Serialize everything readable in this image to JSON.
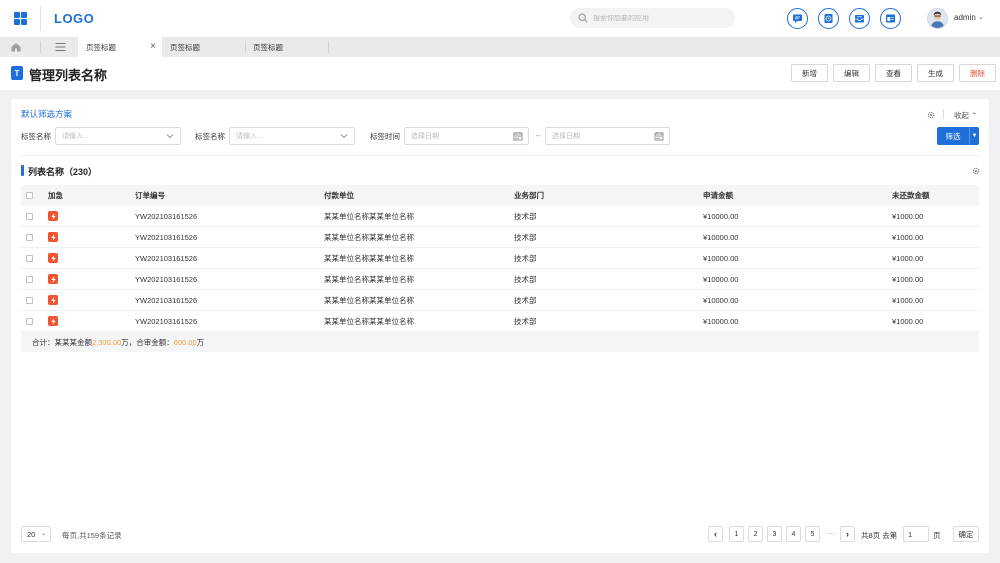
{
  "header": {
    "logo": "LOGO",
    "search_placeholder": "搜索你想要的应用",
    "user_name": "admin"
  },
  "tabs": {
    "items": [
      {
        "label": "页签标题"
      },
      {
        "label": "页签标题"
      },
      {
        "label": "页签标题"
      }
    ]
  },
  "page": {
    "title_icon": "T",
    "title": "管理列表名称",
    "actions": {
      "add": "新增",
      "edit": "编辑",
      "view": "查看",
      "generate": "生成",
      "delete": "删除"
    }
  },
  "filter": {
    "scheme_title": "默认筛选方案",
    "collapse_label": "收起",
    "field1_label": "标签名称",
    "field1_placeholder": "请输入...",
    "field2_label": "标签名称",
    "field2_placeholder": "请输入...",
    "field3_label": "标签时间",
    "date_start_placeholder": "选择日期",
    "date_end_placeholder": "选择日期",
    "range_separator": "–",
    "filter_button": "筛选"
  },
  "list": {
    "title": "列表名称（230）",
    "columns": [
      "加急",
      "订单编号",
      "付款单位",
      "业务部门",
      "申请金额",
      "未还款金额"
    ],
    "rows": [
      {
        "order": "YW202103161526",
        "payer": "某某单位名称某某单位名称",
        "dept": "技术部",
        "apply": "¥10000.00",
        "unpaid": "¥1000.00"
      },
      {
        "order": "YW202103161526",
        "payer": "某某单位名称某某单位名称",
        "dept": "技术部",
        "apply": "¥10000.00",
        "unpaid": "¥1000.00"
      },
      {
        "order": "YW202103161526",
        "payer": "某某单位名称某某单位名称",
        "dept": "技术部",
        "apply": "¥10000.00",
        "unpaid": "¥1000.00"
      },
      {
        "order": "YW202103161526",
        "payer": "某某单位名称某某单位名称",
        "dept": "技术部",
        "apply": "¥10000.00",
        "unpaid": "¥1000.00"
      },
      {
        "order": "YW202103161526",
        "payer": "某某单位名称某某单位名称",
        "dept": "技术部",
        "apply": "¥10000.00",
        "unpaid": "¥1000.00"
      },
      {
        "order": "YW202103161526",
        "payer": "某某单位名称某某单位名称",
        "dept": "技术部",
        "apply": "¥10000.00",
        "unpaid": "¥1000.00"
      }
    ],
    "total": {
      "prefix": "合计：",
      "label1": "某某某金额",
      "value1": "2,300.00",
      "unit1": " 万，",
      "label2": " 合审金额：",
      "value2": "600.00",
      "unit2": " 万"
    }
  },
  "pagination": {
    "page_size": "20",
    "info": "每页,共159条记录",
    "pages": [
      "1",
      "2",
      "3",
      "4",
      "5"
    ],
    "ellipsis": "···",
    "total_label": "共8页 去第",
    "goto_value": "1",
    "unit": "页",
    "confirm": "确定"
  },
  "colors": {
    "primary": "#1e6fd9",
    "urgent": "#f0552f",
    "amount": "#f0a23a",
    "danger": "#e74c3c"
  }
}
